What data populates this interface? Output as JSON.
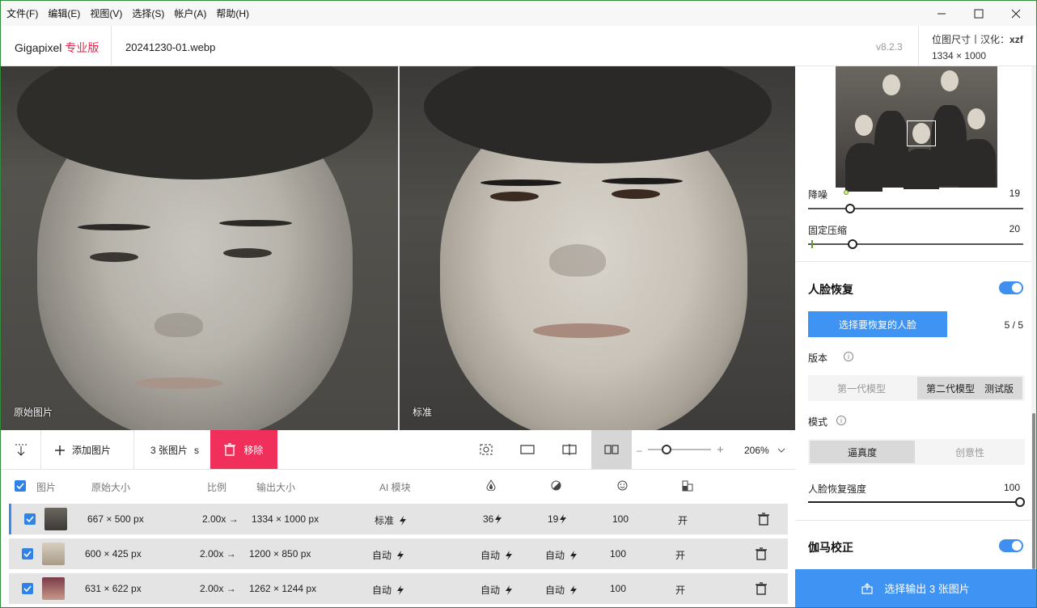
{
  "menu": [
    "文件(F)",
    "编辑(E)",
    "视图(V)",
    "选择(S)",
    "帐户(A)",
    "帮助(H)"
  ],
  "title": {
    "brand": "Gigapixel",
    "edition": "专业版",
    "filename": "20241230-01.webp",
    "version": "v8.2.3",
    "dims_label": "位图尺寸丨汉化：",
    "translator": "xzf",
    "dims_value": "1334 × 1000"
  },
  "preview": {
    "left_label": "原始图片",
    "right_label": "标准"
  },
  "toolbar": {
    "add_images": "添加图片",
    "count_label": "3 张图片",
    "count_suffix": "s",
    "remove": "移除",
    "zoom": "206%",
    "zoom_level": 0.3
  },
  "table": {
    "headers": {
      "image": "图片",
      "original_size": "原始大小",
      "ratio": "比例",
      "output_size": "输出大小",
      "ai_model": "AI 模块"
    },
    "rows": [
      {
        "original": "667 × 500 px",
        "ratio": "2.00x →",
        "output": "1334 × 1000 px",
        "model": "标准",
        "denoise": "36",
        "compress": "19",
        "face": "100",
        "gamma": "开"
      },
      {
        "original": "600 × 425 px",
        "ratio": "2.00x →",
        "output": "1200 × 850 px",
        "model": "自动",
        "denoise": "自动",
        "compress": "自动",
        "face": "100",
        "gamma": "开"
      },
      {
        "original": "631 × 622 px",
        "ratio": "2.00x →",
        "output": "1262 × 1244 px",
        "model": "自动",
        "denoise": "自动",
        "compress": "自动",
        "face": "100",
        "gamma": "开"
      }
    ]
  },
  "panel": {
    "denoise_label": "降噪",
    "denoise_value": "19",
    "compress_label": "固定压缩",
    "compress_value": "20",
    "face_title": "人脸恢复",
    "select_faces": "选择要恢复的人脸",
    "faces_count": "5 / 5",
    "version_label": "版本",
    "version_opt1": "第一代模型",
    "version_opt2": "第二代模型　测试版",
    "mode_label": "模式",
    "mode_opt1": "逼真度",
    "mode_opt2": "创意性",
    "strength_label": "人脸恢复强度",
    "strength_value": "100",
    "gamma_title": "伽马校正",
    "export": "选择输出 3 张图片"
  }
}
